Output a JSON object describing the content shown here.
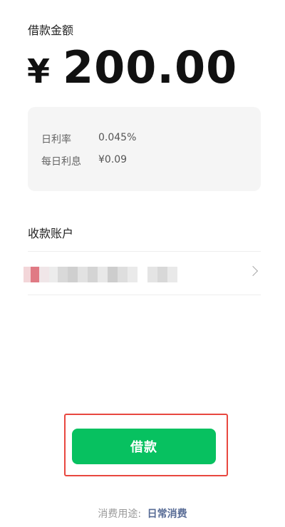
{
  "loan": {
    "amount_label": "借款金额",
    "currency_symbol": "¥",
    "amount": "200.00"
  },
  "rate_card": {
    "daily_rate_label": "日利率",
    "daily_rate_value": "0.045%",
    "daily_interest_label": "每日利息",
    "daily_interest_value": "¥0.09"
  },
  "account": {
    "label": "收款账户",
    "masked_value_note": "pixelated account number"
  },
  "borrow_button": {
    "label": "借款"
  },
  "purpose": {
    "label": "消费用途:",
    "value": "日常消费"
  },
  "colors": {
    "primary_green": "#07c160",
    "highlight_red": "#e8473f",
    "link_blue": "#576b95",
    "card_bg": "#f5f5f5"
  }
}
